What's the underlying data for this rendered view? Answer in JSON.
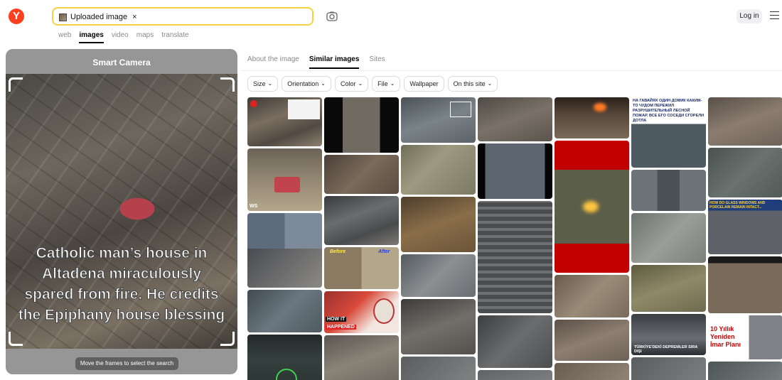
{
  "header": {
    "logo_letter": "Y",
    "search_chip_label": "Uploaded image",
    "search_chip_close": "×",
    "login_label": "Log in",
    "services": [
      {
        "label": "web",
        "active": false
      },
      {
        "label": "images",
        "active": true
      },
      {
        "label": "video",
        "active": false
      },
      {
        "label": "maps",
        "active": false
      },
      {
        "label": "translate",
        "active": false
      }
    ]
  },
  "camera": {
    "title": "Smart Camera",
    "overlay_text": "Catholic man’s house in Altadena miraculously spared from fire. He credits the Epiphany house blessing",
    "hint": "Move the frames to select the search area"
  },
  "tabs": [
    {
      "label": "About the image",
      "active": false
    },
    {
      "label": "Similar images",
      "active": true
    },
    {
      "label": "Sites",
      "active": false
    }
  ],
  "filters": [
    {
      "label": "Size",
      "dropdown": true
    },
    {
      "label": "Orientation",
      "dropdown": true
    },
    {
      "label": "Color",
      "dropdown": true
    },
    {
      "label": "File",
      "dropdown": true
    },
    {
      "label": "Wallpaper",
      "dropdown": false
    },
    {
      "label": "On this site",
      "dropdown": true
    }
  ],
  "thumb_texts": {
    "c3_before": "Before",
    "c3_after": "After",
    "c3_howit": "HOW IT",
    "c3_happened": "HAPPENED",
    "c6_ru": "НА ГАВАЙЯХ ОДИН ДОМИК КАКИМ-ТО ЧУДОМ ПЕРЕЖИЛ РАЗРУШИТЕЛЬНЫЙ ЛЕСНОЙ ПОЖАР. ВСЕ ЕГО СОСЕДИ СГОРЕЛИ ДОТЛА",
    "c6_turkey": "TÜRKİYE'DEKİ DEPREMLER SIRA DIŞI",
    "c7_glass": "HOW DO GLASS WINDOWS AND PORCELAIN REMAIN INTACT...",
    "c7_tr1": "10 Yıllık",
    "c7_tr2": "Yeniden",
    "c7_tr3": "İmar Planı",
    "c2_ws": "WS"
  },
  "colors": {
    "accent_yellow": "#f5d33f",
    "logo_red": "#fc3f1d",
    "panel_gray": "#969696"
  }
}
